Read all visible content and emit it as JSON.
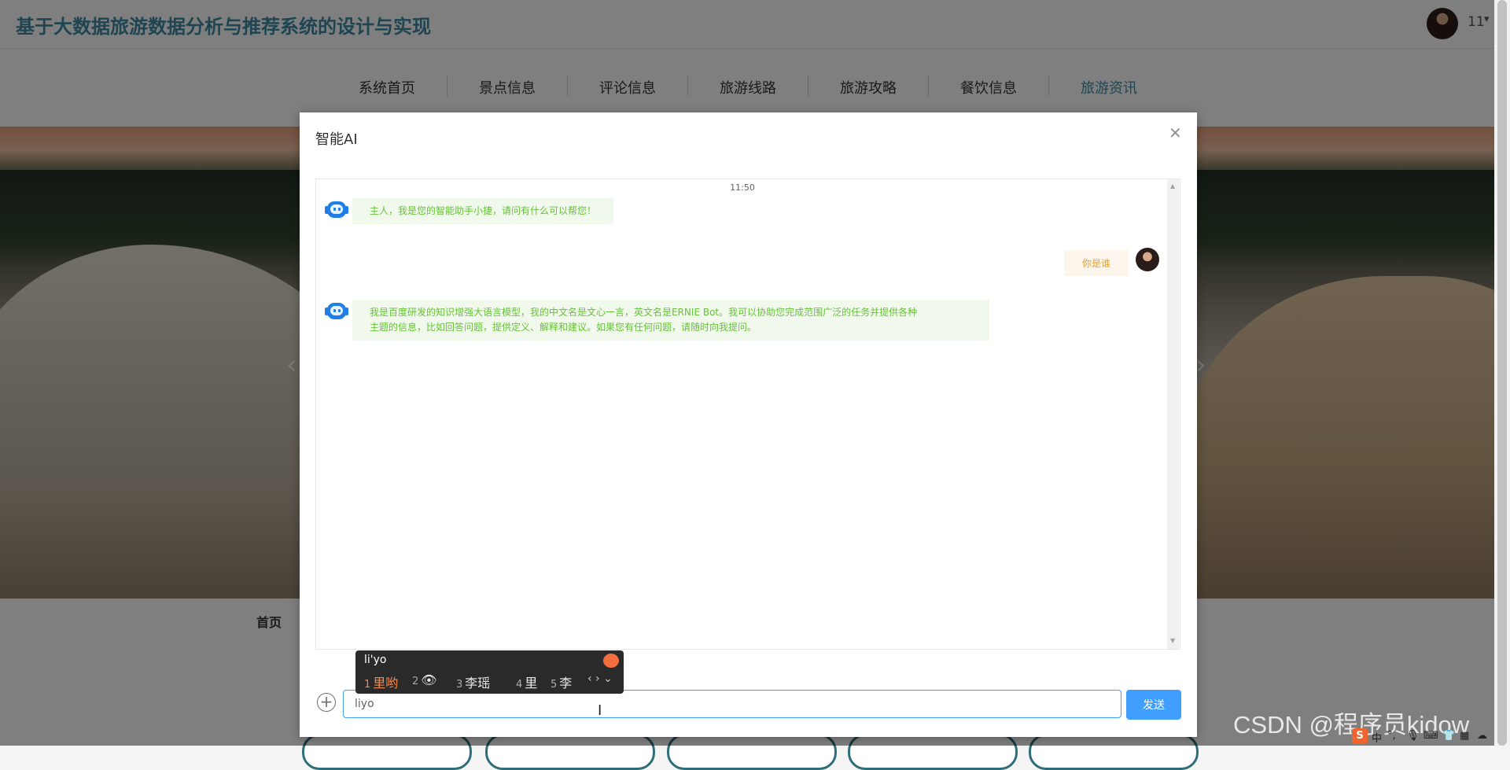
{
  "site": {
    "title": "基于大数据旅游数据分析与推荐系统的设计与实现"
  },
  "user": {
    "name": "11",
    "avatar_icon": "user-avatar",
    "caret_icon": "caret-down-icon"
  },
  "nav": {
    "items": [
      "系统首页",
      "景点信息",
      "评论信息",
      "旅游线路",
      "旅游攻略",
      "餐饮信息",
      "旅游资讯"
    ],
    "active": "旅游资讯"
  },
  "breadcrumb": {
    "home": "首页"
  },
  "dialog": {
    "title": "智能AI",
    "close_icon": "close-icon",
    "timestamp": "11:50",
    "messages": [
      {
        "role": "bot",
        "text": "主人，我是您的智能助手小捷，请问有什么可以帮您！"
      },
      {
        "role": "user",
        "text": "你是谁"
      },
      {
        "role": "bot",
        "lines": [
          "我是百度研发的知识增强大语言模型，我的中文名是文心一言，英文名是ERNIE Bot。我可以协助您完成范围广泛的任务并提供各种",
          "主题的信息，比如回答问题，提供定义、解释和建议。如果您有任何问题，请随时向我提问。"
        ]
      }
    ],
    "input_value": "liyo",
    "send_label": "发送",
    "add_icon": "plus-circle-icon"
  },
  "ime": {
    "composition": "li'yo",
    "candidates": [
      {
        "n": "1",
        "text": "里哟"
      },
      {
        "n": "2",
        "text": "👁"
      },
      {
        "n": "3",
        "text": "李瑶"
      },
      {
        "n": "4",
        "text": "里"
      },
      {
        "n": "5",
        "text": "李"
      }
    ],
    "selected_index": 0
  },
  "watermark": "CSDN @程序员kidow",
  "tray": {
    "ime_mode": "中",
    "punct": "°,"
  },
  "colors": {
    "accent": "#409eff",
    "brand": "#3c8aa3",
    "bot_text": "#67c23a",
    "bot_bg": "#f0f9eb",
    "user_text": "#e6a23c",
    "user_bg": "#fdf6ec"
  }
}
